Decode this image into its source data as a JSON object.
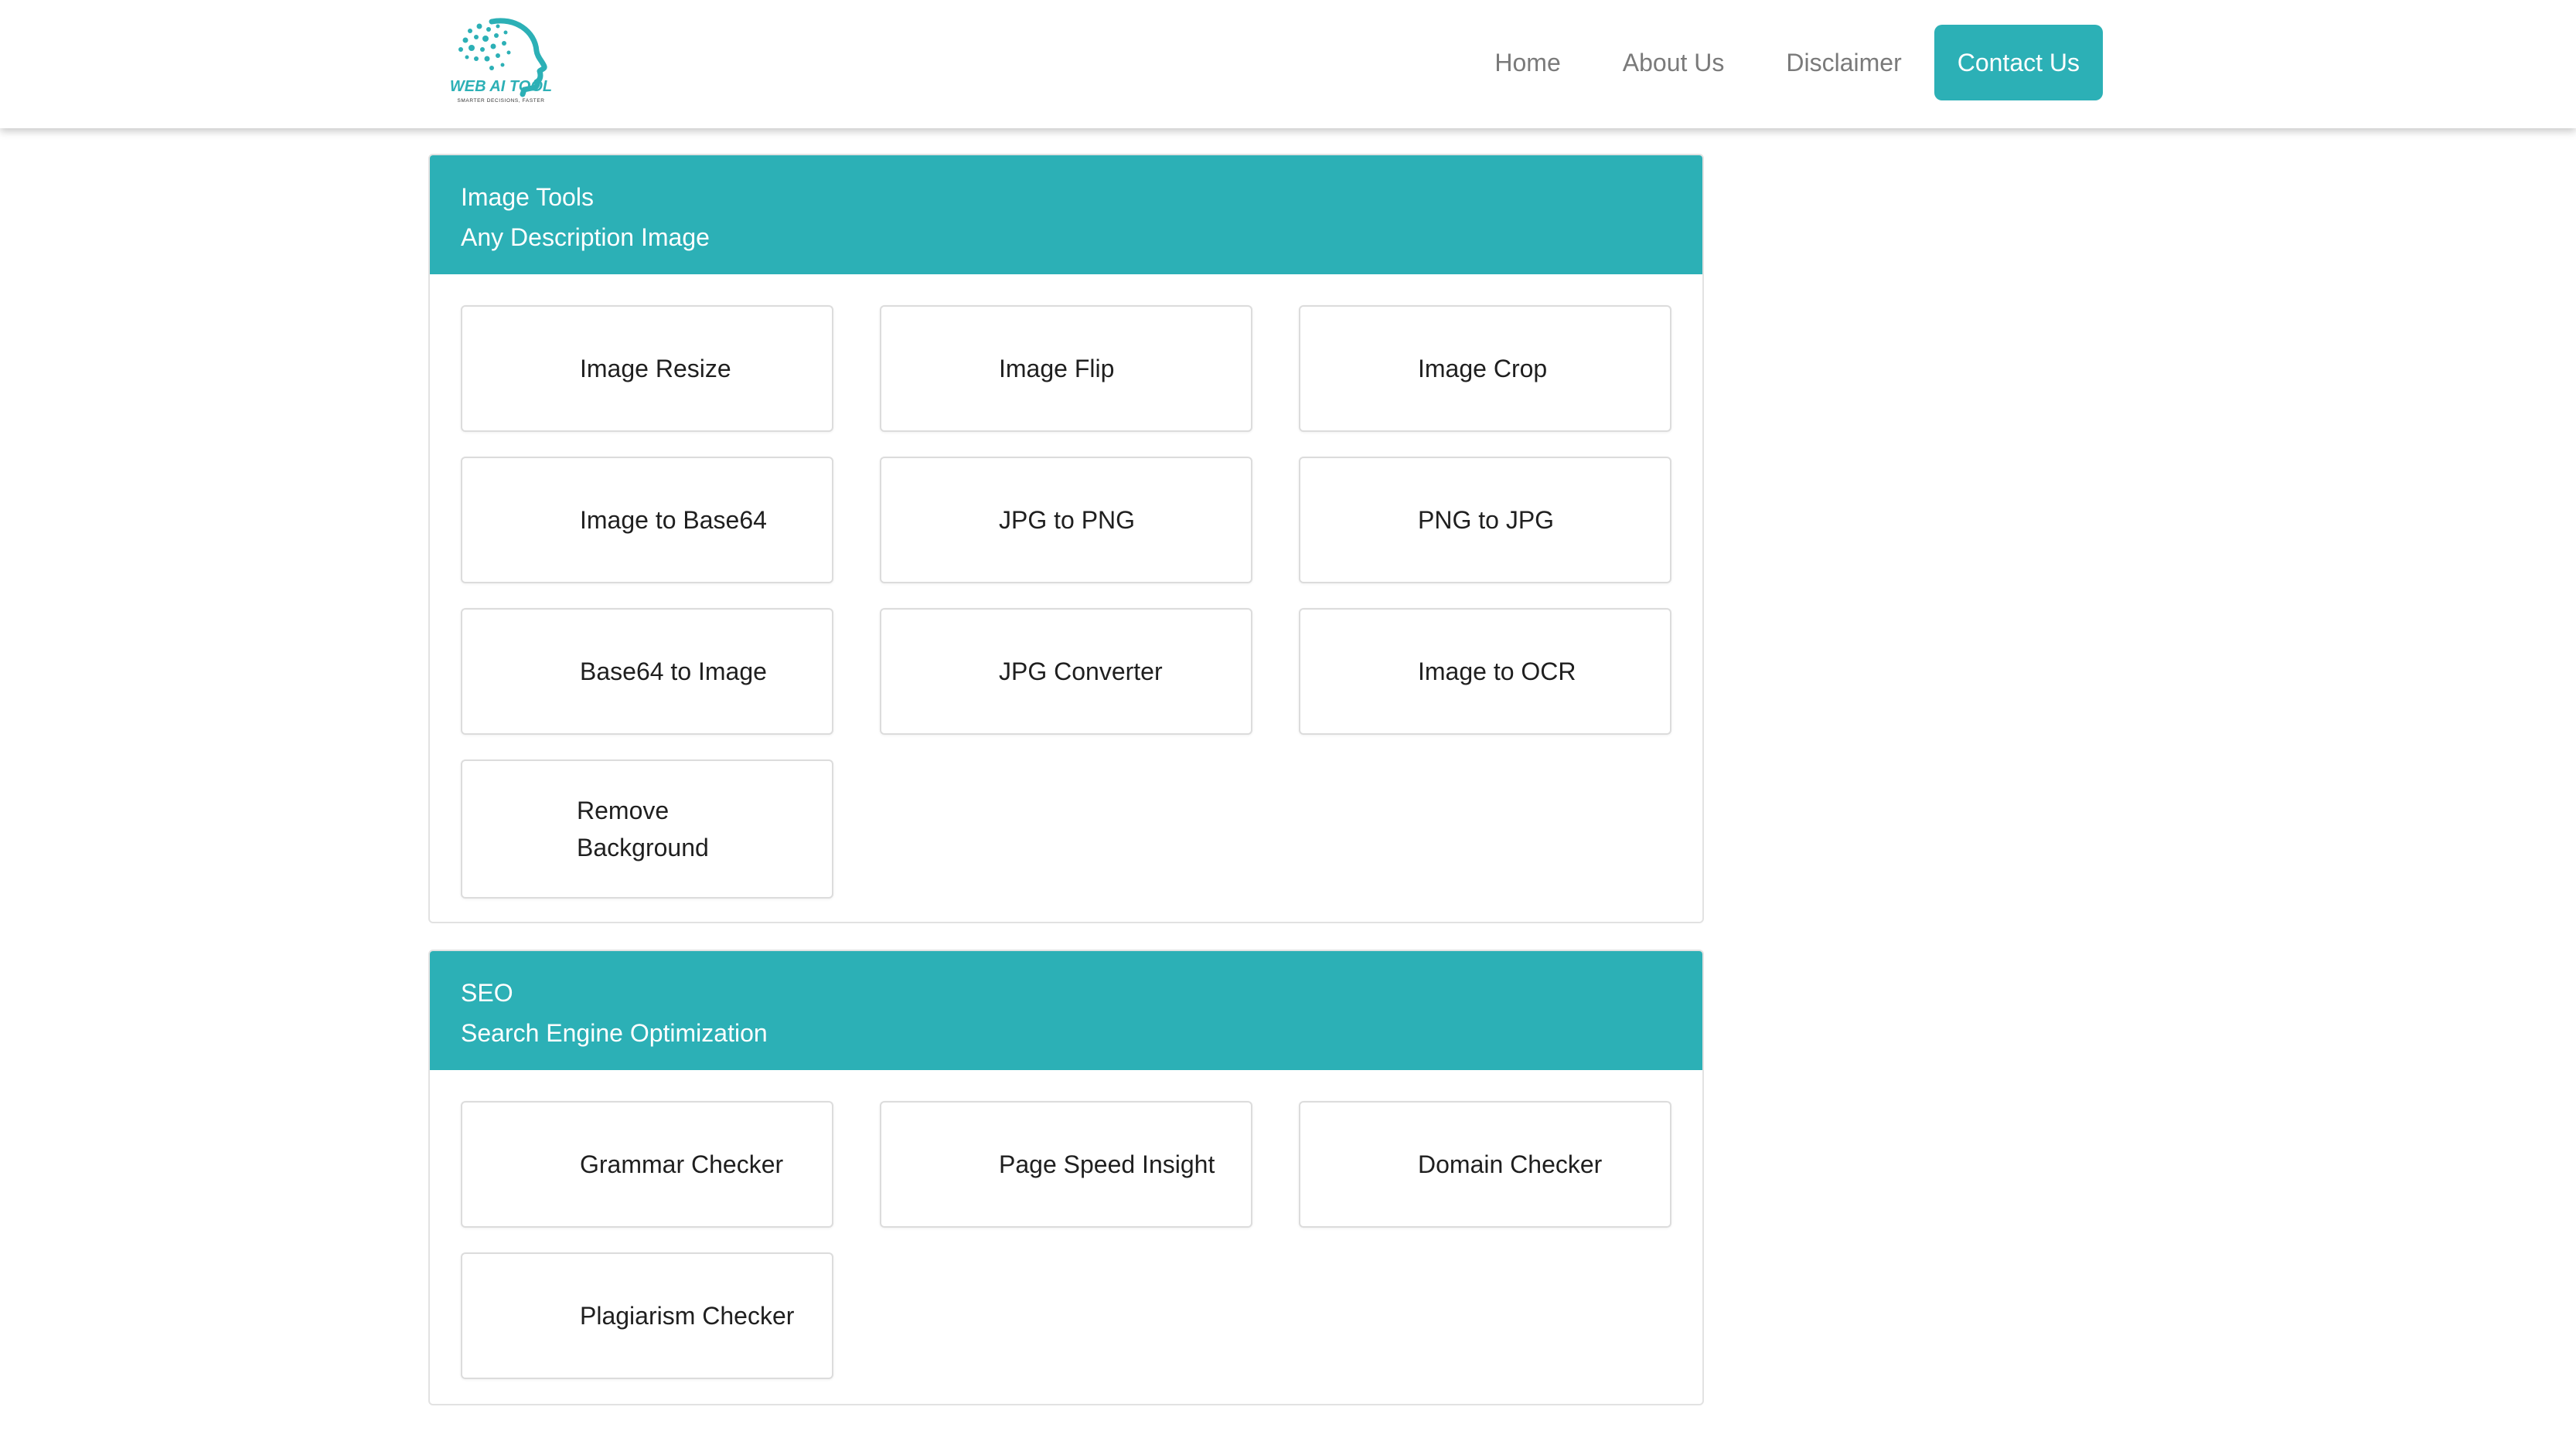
{
  "brand": {
    "logo_text": "WEB AI TOOL",
    "logo_tagline": "SMARTER DECISIONS, FASTER",
    "accent_color": "#2cb0b6"
  },
  "nav": {
    "home": "Home",
    "about": "About Us",
    "disclaimer": "Disclaimer",
    "contact": "Contact Us"
  },
  "sections": [
    {
      "title": "Image Tools",
      "subtitle": "Any Description Image",
      "tools": [
        "Image Resize",
        "Image Flip",
        "Image Crop",
        "Image to Base64",
        "JPG to PNG",
        "PNG to JPG",
        "Base64 to Image",
        "JPG Converter",
        "Image to OCR",
        "Remove Background"
      ]
    },
    {
      "title": "SEO",
      "subtitle": "Search Engine Optimization",
      "tools": [
        "Grammar Checker",
        "Page Speed Insight",
        "Domain Checker",
        "Plagiarism Checker"
      ]
    }
  ]
}
